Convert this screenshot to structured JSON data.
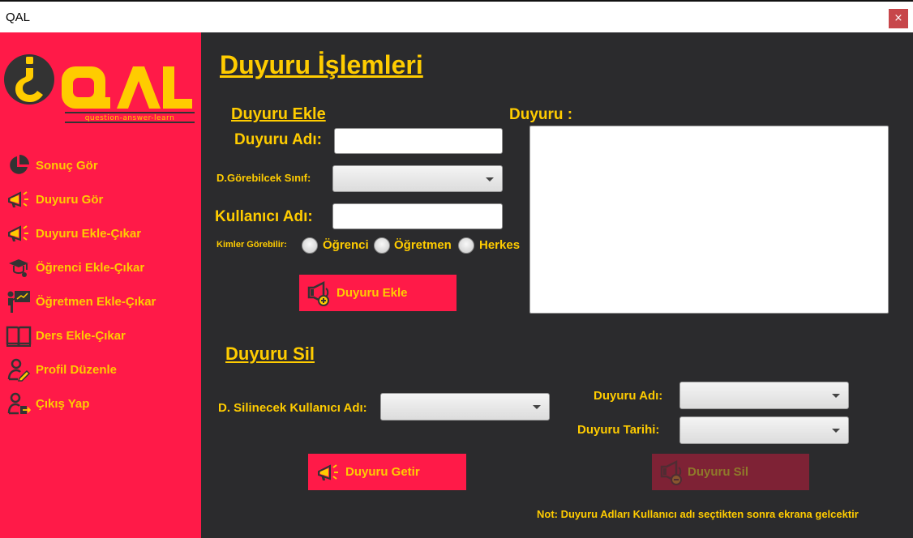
{
  "window": {
    "title": "QAL",
    "close_glyph": "×"
  },
  "logo": {
    "brand": "QAL",
    "tagline": "question-answer-learn"
  },
  "sidebar": {
    "items": [
      {
        "label": "Sonuç Gör",
        "icon": "pie-chart-icon"
      },
      {
        "label": "Duyuru Gör",
        "icon": "megaphone-icon"
      },
      {
        "label": "Duyuru Ekle-Çıkar",
        "icon": "megaphone-icon"
      },
      {
        "label": "Öğrenci Ekle-Çıkar",
        "icon": "graduate-icon"
      },
      {
        "label": "Öğretmen Ekle-Çıkar",
        "icon": "teacher-icon"
      },
      {
        "label": "Ders Ekle-Çıkar",
        "icon": "book-icon"
      },
      {
        "label": "Profil Düzenle",
        "icon": "user-edit-icon"
      },
      {
        "label": "Çıkış Yap",
        "icon": "user-logout-icon"
      }
    ]
  },
  "main": {
    "page_title": "Duyuru İşlemleri",
    "add": {
      "heading": "Duyuru Ekle",
      "name_label": "Duyuru Adı:",
      "name_value": "",
      "class_label": "D.Görebilcek Sınıf:",
      "class_value": "",
      "user_label": "Kullanıcı Adı:",
      "user_value": "",
      "visibility_label": "Kimler Görebilir:",
      "visibility_options": [
        "Öğrenci",
        "Öğretmen",
        "Herkes"
      ],
      "button_label": "Duyuru Ekle"
    },
    "announcement": {
      "label": "Duyuru :",
      "value": ""
    },
    "delete": {
      "heading": "Duyuru Sil",
      "user_label": "D. Silinecek Kullanıcı Adı:",
      "user_value": "",
      "name_label": "Duyuru Adı:",
      "name_value": "",
      "date_label": "Duyuru Tarihi:",
      "date_value": "",
      "fetch_button": "Duyuru Getir",
      "delete_button": "Duyuru Sil"
    },
    "note": "Not: Duyuru Adları Kullanıcı adı seçtikten sonra ekrana gelcektir"
  },
  "colors": {
    "sidebar": "#ff1a48",
    "accent": "#ffcc00",
    "background": "#2b2b2d"
  }
}
